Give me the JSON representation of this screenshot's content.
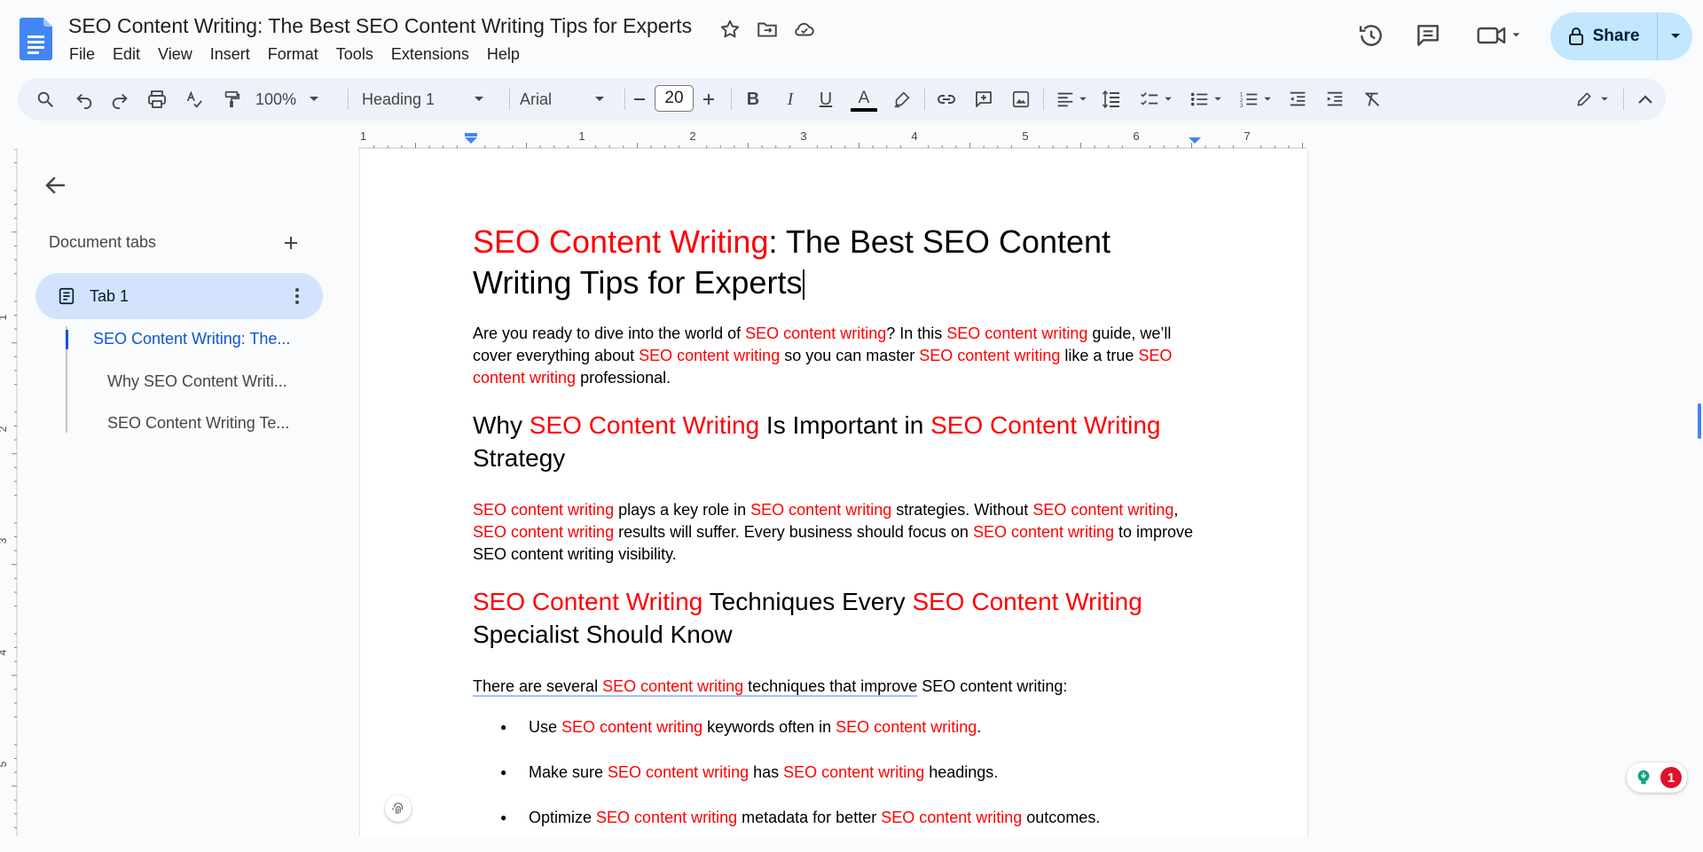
{
  "header": {
    "doc_title": "SEO Content Writing: The Best SEO Content Writing Tips for Experts",
    "menu": [
      "File",
      "Edit",
      "View",
      "Insert",
      "Format",
      "Tools",
      "Extensions",
      "Help"
    ],
    "share_label": "Share"
  },
  "toolbar": {
    "zoom": "100%",
    "style": "Heading 1",
    "font": "Arial",
    "font_size": "20"
  },
  "ruler": {
    "labels": [
      "1",
      "1",
      "2",
      "3",
      "4",
      "5",
      "6",
      "7"
    ]
  },
  "vruler": {
    "labels": [
      "1",
      "2",
      "3",
      "4",
      "5"
    ]
  },
  "sidebar": {
    "title": "Document tabs",
    "tab": "Tab 1",
    "outline": [
      "SEO Content Writing: The...",
      "Why SEO Content Writi...",
      "SEO Content Writing Te..."
    ]
  },
  "notifications": {
    "count": "1"
  },
  "doc": {
    "h1": {
      "a": "SEO Content Writing",
      "b": ": The Best SEO Content Writing Tips for Experts"
    },
    "p1": {
      "a": "Are you ready to dive into the world of ",
      "b": "SEO content writing",
      "c": "? In this ",
      "d": "SEO content writing",
      "e": " guide, we’ll cover everything about ",
      "f": "SEO content writing",
      "g": " so you can master ",
      "h": "SEO content writing",
      "i": " like a true ",
      "j": "SEO content writing",
      "k": " professional."
    },
    "h2a": {
      "a": "Why ",
      "b": "SEO Content Writing",
      "c": " Is Important in ",
      "d": "SEO Content Writing",
      "e": " Strategy"
    },
    "p2": {
      "a": "SEO content writing",
      "b": " plays a key role in ",
      "c": "SEO content writing",
      "d": " strategies. Without ",
      "e": "SEO content writing",
      "f": ", ",
      "g": "SEO content writing",
      "h": " results will suffer. Every business should focus on ",
      "i": "SEO content writing",
      "j": " to improve SEO content writing visibility."
    },
    "h2b": {
      "a": "SEO Content Writing",
      "b": " Techniques Every ",
      "c": "SEO Content Writing",
      "d": " Specialist Should Know"
    },
    "p3": {
      "a": "There are several ",
      "b": "SEO content writing",
      "c": " techniques that improve",
      "d": " SEO content writing:"
    },
    "bullets": [
      {
        "a": "Use ",
        "b": "SEO content writing",
        "c": " keywords often in ",
        "d": "SEO content writing",
        "e": "."
      },
      {
        "a": "Make sure ",
        "b": "SEO content writing",
        "c": " has ",
        "d": "SEO content writing",
        "e": " headings."
      },
      {
        "a": "Optimize ",
        "b": "SEO content writing",
        "c": " metadata for better ",
        "d": "SEO content writing",
        "e": " outcomes."
      }
    ]
  }
}
